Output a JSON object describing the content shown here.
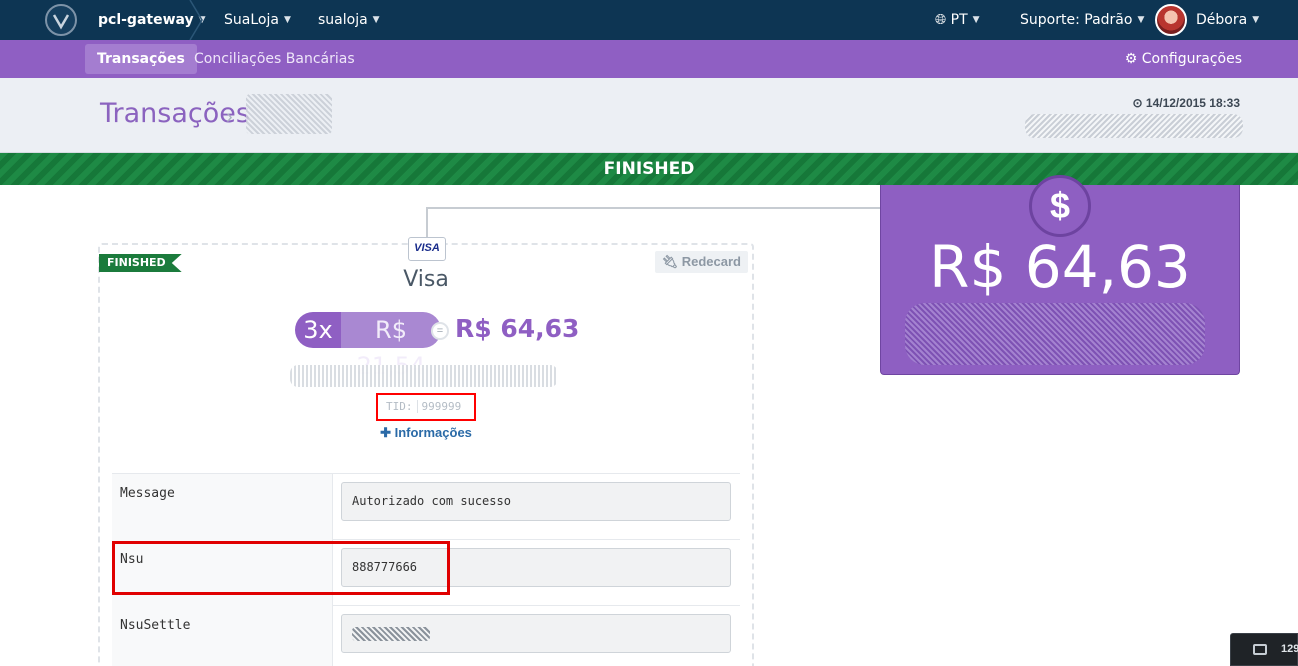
{
  "topbar": {
    "app": "pcl-gateway",
    "store": "SuaLoja",
    "account": "sualoja",
    "language": "PT",
    "support_label": "Suporte:",
    "support_value": "Padrão",
    "user": "Débora"
  },
  "subnav": {
    "tabs": [
      {
        "label": "Transações",
        "active": true
      },
      {
        "label": "Conciliações Bancárias",
        "active": false
      }
    ],
    "settings": "Configurações"
  },
  "header": {
    "title": "Transações",
    "datetime": "14/12/2015 18:33"
  },
  "status": "FINISHED",
  "amount_panel": {
    "symbol": "$",
    "amount": "R$ 64,63"
  },
  "card": {
    "ribbon": "FINISHED",
    "brand_logo": "VISA",
    "brand": "Visa",
    "acquirer": "Redecard",
    "installments": {
      "count": "3x",
      "value": "R$ 21,54",
      "equals": "=",
      "total": "R$ 64,63"
    },
    "tid_label": "TID:",
    "tid_value": "999999",
    "more_info": "Informações",
    "details": [
      {
        "label": "Message",
        "value": "Autorizado com sucesso"
      },
      {
        "label": "Nsu",
        "value": "888777666"
      },
      {
        "label": "NsuSettle",
        "value": ""
      }
    ]
  },
  "tray": {
    "number": "129"
  },
  "colors": {
    "topbar": "#0d3553",
    "purple": "#8f5fc3",
    "green": "#1e8a45",
    "highlight": "#ff0000"
  }
}
